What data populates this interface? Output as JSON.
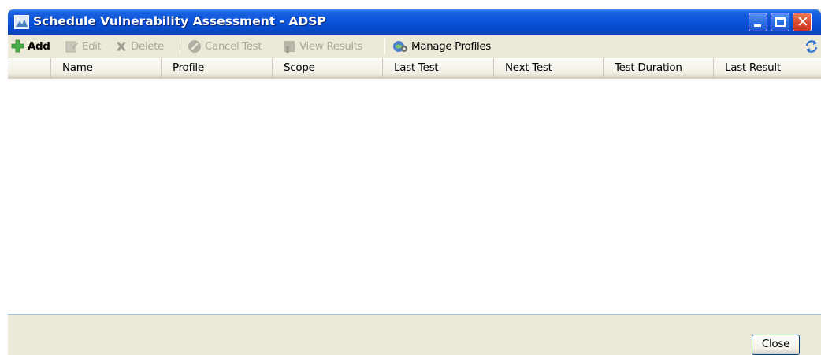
{
  "window": {
    "title": "Schedule Vulnerability Assessment - ADSP",
    "icon": "app-icon"
  },
  "titlebar_buttons": [
    {
      "name": "minimize",
      "icon": "minimize-icon"
    },
    {
      "name": "maximize",
      "icon": "maximize-icon"
    },
    {
      "name": "close",
      "icon": "close-icon"
    }
  ],
  "toolbar": {
    "add_label": "Add",
    "edit_label": "Edit",
    "delete_label": "Delete",
    "cancel_test_label": "Cancel Test",
    "view_results_label": "View Results",
    "manage_profiles_label": "Manage Profiles",
    "disabled_items": [
      "Edit",
      "Delete",
      "Cancel Test",
      "View Results"
    ],
    "refresh_icon": "refresh-icon"
  },
  "table": {
    "columns": [
      "",
      "Name",
      "Profile",
      "Scope",
      "Last Test",
      "Next Test",
      "Test Duration",
      "Last Result"
    ],
    "rows": []
  },
  "footer": {
    "close_label": "Close"
  },
  "colors": {
    "titlebar": "#0549c8",
    "face": "#ece9d8",
    "disabled_text": "#aca899",
    "add_icon": "#3aa53a"
  }
}
